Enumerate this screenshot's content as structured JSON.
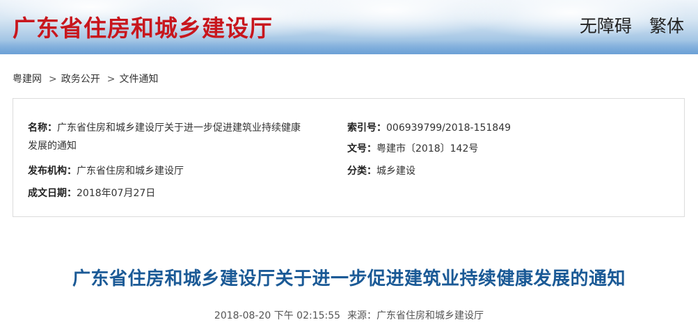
{
  "header": {
    "site_title": "广东省住房和城乡建设厅",
    "links": [
      "无障碍",
      "繁体"
    ]
  },
  "breadcrumb": {
    "items": [
      "粤建网",
      "政务公开",
      "文件通知"
    ],
    "separator": ">"
  },
  "info": {
    "name_label": "名称：",
    "name_value_line1": "广东省住房和城乡建设厅关于进一步促进建筑业持续健康",
    "name_value_line2": "发展的通知",
    "index_label": "索引号：",
    "index_value": "006939799/2018-151849",
    "docno_label": "文号：",
    "docno_value": "粤建市〔2018〕142号",
    "publisher_label": "发布机构：",
    "publisher_value": "广东省住房和城乡建设厅",
    "category_label": "分类：",
    "category_value": "城乡建设",
    "date_label": "成文日期：",
    "date_value": "2018年07月27日"
  },
  "article": {
    "title": "广东省住房和城乡建设厅关于进一步促进建筑业持续健康发展的通知",
    "datetime": "2018-08-20 下午 02:15:55",
    "source_label": "来源：",
    "source_value": "广东省住房和城乡建设厅"
  },
  "colors": {
    "site_title": "#c8161d",
    "article_title": "#1b5a96"
  }
}
